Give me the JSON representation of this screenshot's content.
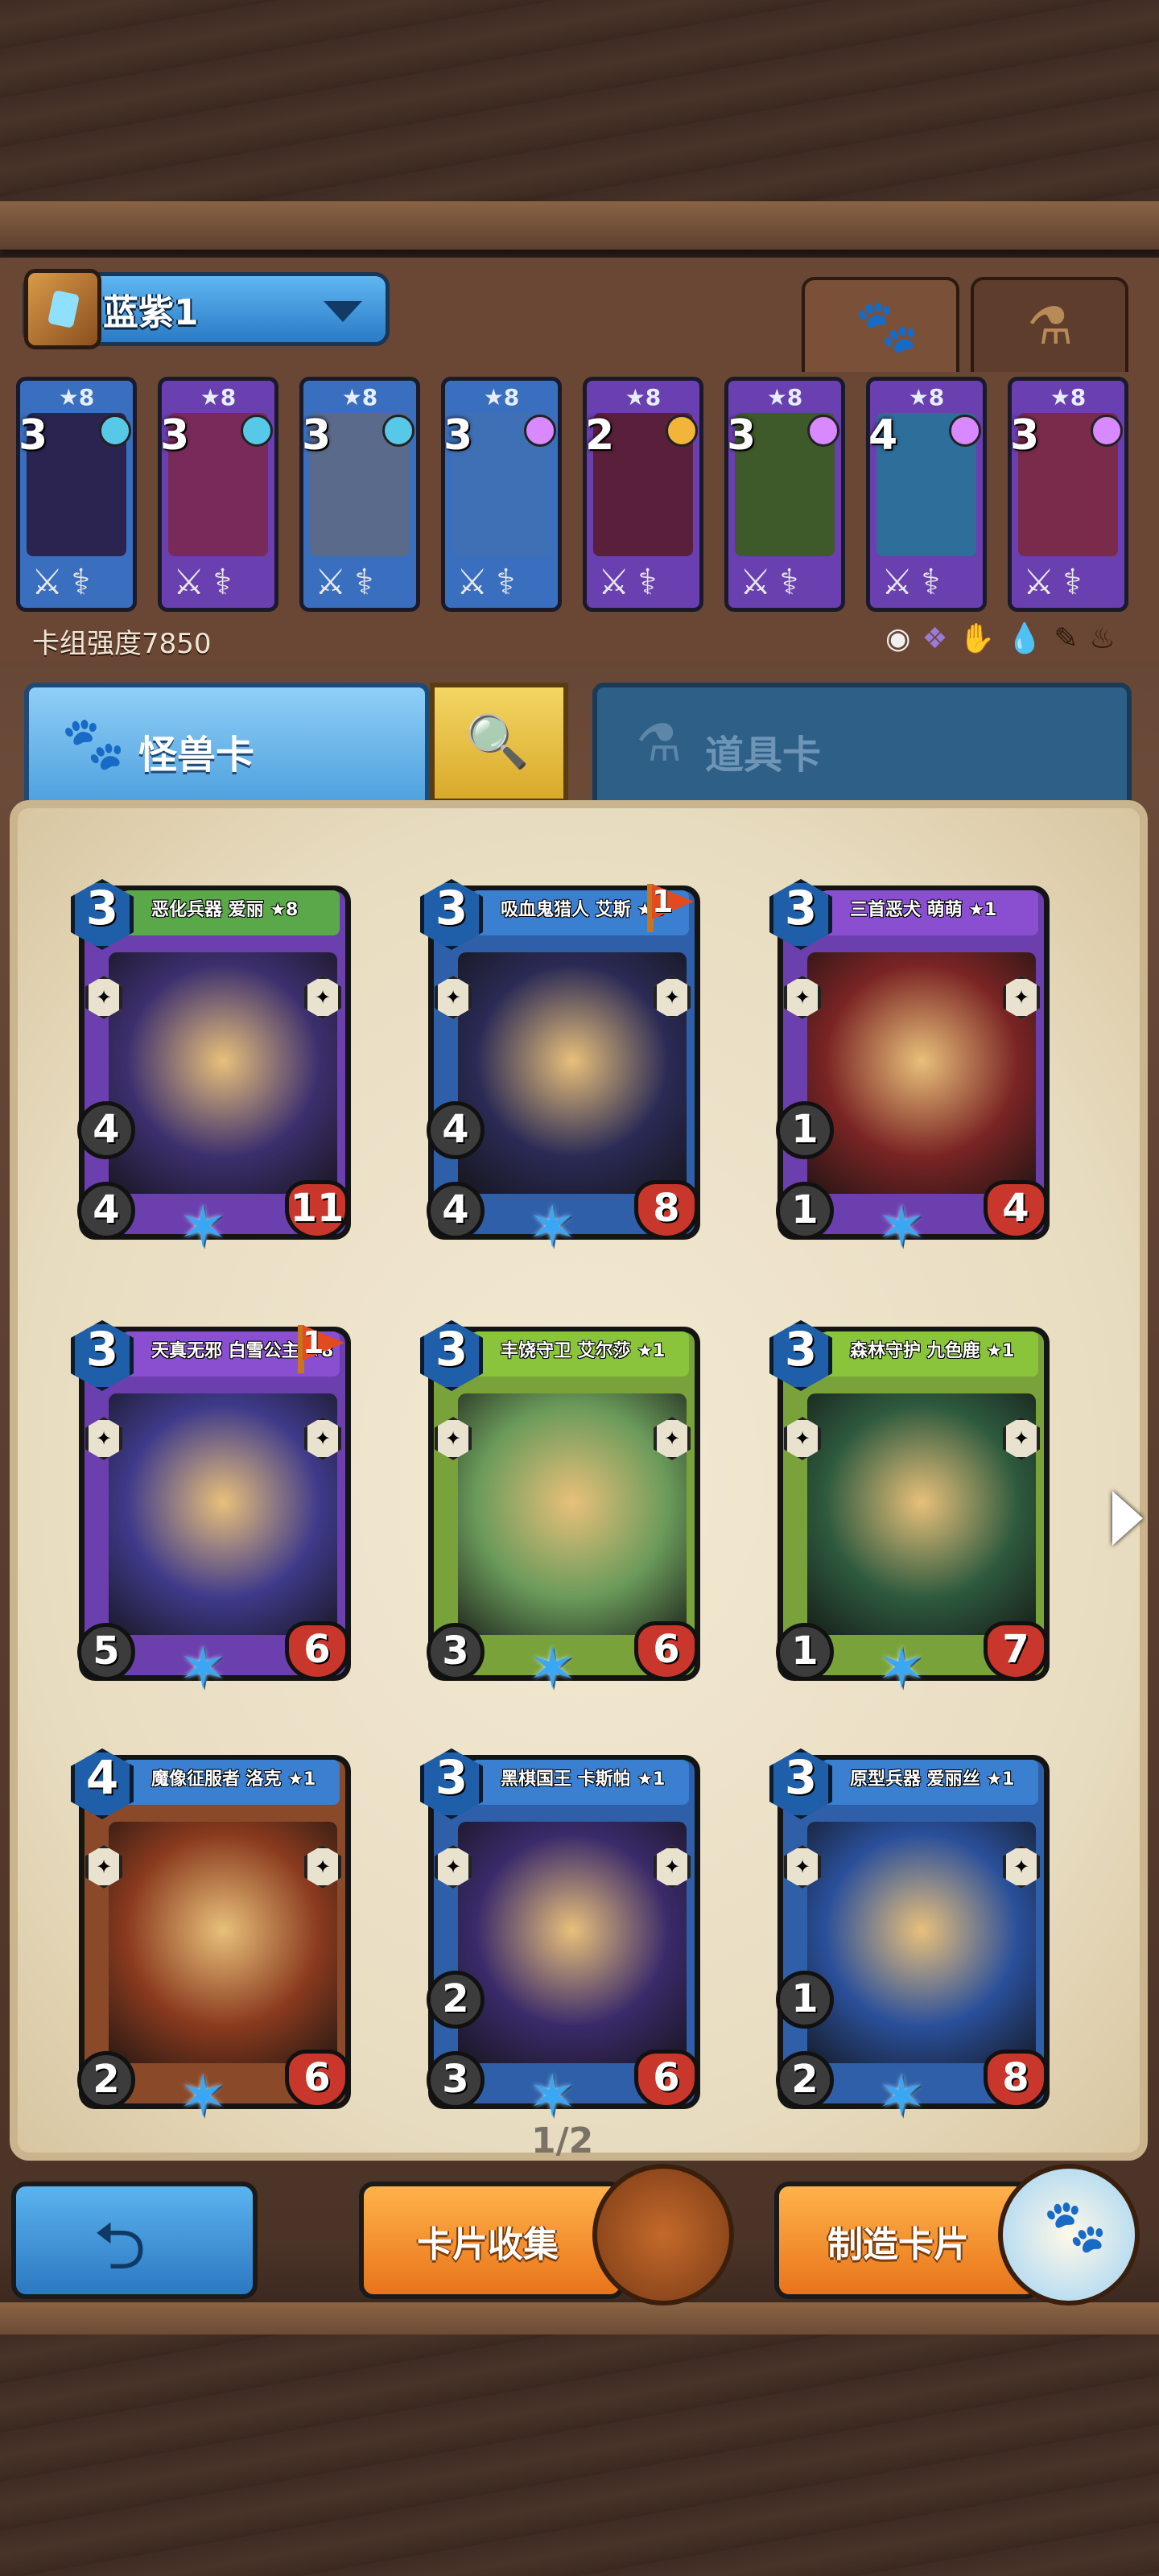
{
  "deck": {
    "name": "蓝紫1",
    "strength_label": "卡组强度7850",
    "mini_cards": [
      {
        "cost": "3",
        "stars": "★8",
        "frame": "#3a6fbf",
        "art": "#2b2450",
        "gem": "#58c8e8"
      },
      {
        "cost": "3",
        "stars": "★8",
        "frame": "#6a3fb0",
        "art": "#7a2a5a",
        "gem": "#58c8e8"
      },
      {
        "cost": "3",
        "stars": "★8",
        "frame": "#3a6fbf",
        "art": "#5a6a8a",
        "gem": "#58c8e8"
      },
      {
        "cost": "3",
        "stars": "★8",
        "frame": "#3a6fbf",
        "art": "#3f6fb4",
        "gem": "#d889ff"
      },
      {
        "cost": "2",
        "stars": "★8",
        "frame": "#6a3fb0",
        "art": "#5a1f3a",
        "gem": "#f2b53a"
      },
      {
        "cost": "3",
        "stars": "★8",
        "frame": "#6a3fb0",
        "art": "#3f5a2a",
        "gem": "#d889ff"
      },
      {
        "cost": "4",
        "stars": "★8",
        "frame": "#6a3fb0",
        "art": "#2e6e9a",
        "gem": "#d889ff"
      },
      {
        "cost": "3",
        "stars": "★8",
        "frame": "#6a3fb0",
        "art": "#7a2a4a",
        "gem": "#d889ff"
      }
    ]
  },
  "tabs": {
    "monster": "怪兽卡",
    "item": "道具卡"
  },
  "cards": [
    {
      "name": "恶化兵器 爱丽 ★8",
      "cost": "3",
      "speed": "4",
      "attack": "4",
      "hp": "11",
      "frame": "#6c3fae",
      "banner": "#5aa84a",
      "art": "#3c2f6e",
      "flag": ""
    },
    {
      "name": "吸血鬼猎人 艾斯 ★8",
      "cost": "3",
      "speed": "4",
      "attack": "4",
      "hp": "8",
      "frame": "#2f5fa8",
      "banner": "#3a7fd0",
      "art": "#2a2a55",
      "flag": "1"
    },
    {
      "name": "三首恶犬 萌萌 ★1",
      "cost": "3",
      "speed": "1",
      "attack": "1",
      "hp": "4",
      "frame": "#6c3fae",
      "banner": "#8a4fd0",
      "art": "#7a2424",
      "flag": ""
    },
    {
      "name": "天真无邪 白雪公主 ★8",
      "cost": "3",
      "speed": "",
      "attack": "5",
      "hp": "6",
      "frame": "#6c3fae",
      "banner": "#8a4fd0",
      "art": "#3f3a8a",
      "flag": "1"
    },
    {
      "name": "丰饶守卫 艾尔莎 ★1",
      "cost": "3",
      "speed": "",
      "attack": "3",
      "hp": "6",
      "frame": "#7aa23a",
      "banner": "#8ac43a",
      "art": "#6a9a5a",
      "flag": ""
    },
    {
      "name": "森林守护 九色鹿 ★1",
      "cost": "3",
      "speed": "",
      "attack": "1",
      "hp": "7",
      "frame": "#7aa23a",
      "banner": "#8ac43a",
      "art": "#2e5a3e",
      "flag": ""
    },
    {
      "name": "魔像征服者 洛克 ★1",
      "cost": "4",
      "speed": "",
      "attack": "2",
      "hp": "6",
      "frame": "#8a4a2a",
      "banner": "#3a7fd0",
      "art": "#8a3a1e",
      "flag": ""
    },
    {
      "name": "黑棋国王 卡斯帕 ★1",
      "cost": "3",
      "speed": "2",
      "attack": "3",
      "hp": "6",
      "frame": "#2f5fa8",
      "banner": "#3a7fd0",
      "art": "#3a2a6a",
      "flag": ""
    },
    {
      "name": "原型兵器 爱丽丝 ★1",
      "cost": "3",
      "speed": "1",
      "attack": "2",
      "hp": "8",
      "frame": "#2f5fa8",
      "banner": "#3a7fd0",
      "art": "#2a4f9a",
      "flag": ""
    }
  ],
  "pager": "1/2",
  "buttons": {
    "collect": "卡片收集",
    "craft": "制造卡片"
  },
  "icons": {
    "paw": "paw-icon",
    "potion": "potion-icon",
    "search": "search-icon",
    "back": "back-arrow-icon",
    "next": "next-page-arrow-icon"
  }
}
